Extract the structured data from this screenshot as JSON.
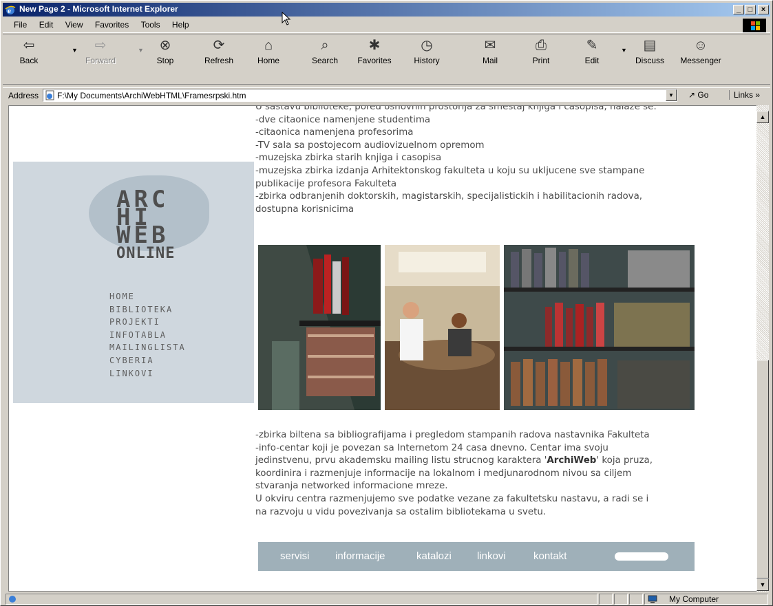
{
  "window": {
    "title": "New Page 2 - Microsoft Internet Explorer",
    "controls": [
      "_",
      "□",
      "×"
    ]
  },
  "menu": [
    "File",
    "Edit",
    "View",
    "Favorites",
    "Tools",
    "Help"
  ],
  "toolbar": {
    "back": "Back",
    "forward": "Forward",
    "stop": "Stop",
    "refresh": "Refresh",
    "home": "Home",
    "search": "Search",
    "favorites": "Favorites",
    "history": "History",
    "mail": "Mail",
    "print": "Print",
    "edit": "Edit",
    "discuss": "Discuss",
    "messenger": "Messenger"
  },
  "address": {
    "label": "Address",
    "url": "F:\\My Documents\\ArchiWebHTML\\Framesrpski.htm",
    "go": "Go",
    "links": "Links"
  },
  "logo": {
    "line1": "ARC",
    "line2": "HI",
    "line3": "WEB",
    "line4": "ONLINE"
  },
  "nav": [
    "HOME",
    "BIBLIOTEKA",
    "PROJEKTI",
    "INFOTABLA",
    "MAILINGLISTA",
    "CYBERIA",
    "LINKOVI"
  ],
  "content": {
    "top_lines": [
      "U sastavu biblioteke, pored osnovnih prostorija za smestaj knjiga i casopisa, nalaze se:",
      "-dve citaonice namenjene studentima",
      "-citaonica namenjena profesorima",
      "-TV sala sa postojecom audiovizuelnom opremom",
      "-muzejska zbirka starih knjiga i casopisa",
      "-muzejska zbirka izdanja Arhitektonskog fakulteta u koju su ukljucene sve stampane",
      "publikacije profesora Fakulteta",
      "-zbirka odbranjenih doktorskih, magistarskih, specijalistickih i habilitacionih radova,",
      "dostupna korisnicima"
    ],
    "bottom": {
      "l1": "-zbirka biltena sa bibliografijama i pregledom stampanih radova nastavnika Fakulteta",
      "l2": "-info-centar koji je povezan sa Internetom 24 casa dnevno. Centar ima svoju",
      "l3a": "jedinstvenu, prvu akademsku mailing listu strucnog karaktera '",
      "l3b": "ArchiWeb",
      "l3c": "'  koja pruza,",
      "l4": "koordinira i razmenjuje informacije na lokalnom i medjunarodnom nivou  sa ciljem",
      "l5": "stvaranja networked informacione mreze.",
      "l6": "U okviru centra razmenjujemo sve podatke vezane za fakultetsku nastavu,  a radi se i",
      "l7": "na razvoju u vidu povezivanja sa ostalim bibliotekama u svetu."
    }
  },
  "footer_nav": [
    "servisi",
    "informacije",
    "katalozi",
    "linkovi",
    "kontakt"
  ],
  "status": {
    "zone": "My Computer"
  },
  "colors": {
    "titlebar_start": "#0a246a",
    "titlebar_end": "#a6caf0",
    "left_panel": "#cfd7de",
    "footer_nav_bg": "#9fb0b9"
  }
}
